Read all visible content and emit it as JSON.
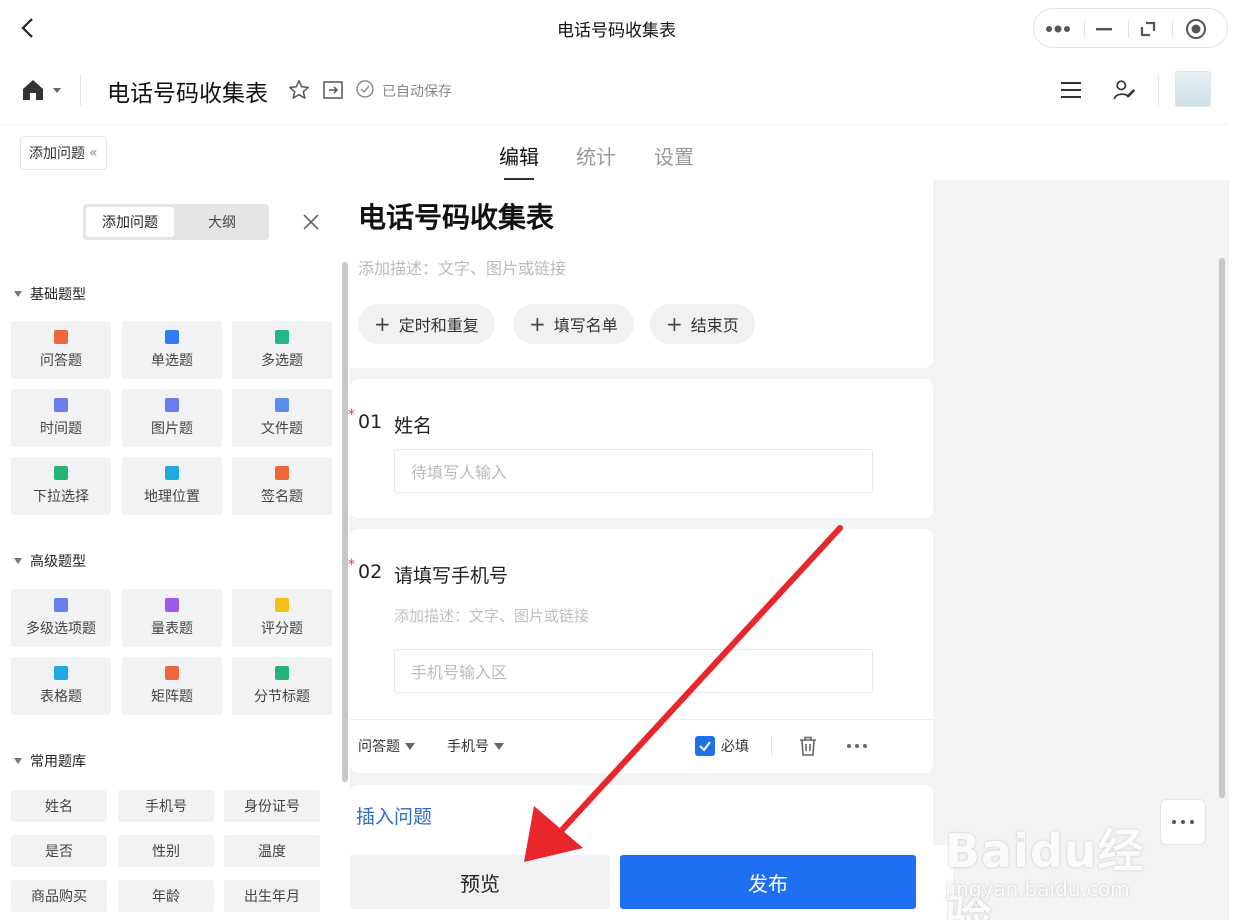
{
  "window": {
    "title": "电话号码收集表"
  },
  "doc": {
    "title": "电话号码收集表",
    "autosave": "已自动保存"
  },
  "tabs": {
    "add_question_btn": "添加问题",
    "items": [
      "编辑",
      "统计",
      "设置"
    ],
    "active": "编辑"
  },
  "left_panel": {
    "segment": [
      "添加问题",
      "大纲"
    ],
    "basic": {
      "heading": "基础题型",
      "items": [
        "问答题",
        "单选题",
        "多选题",
        "时间题",
        "图片题",
        "文件题",
        "下拉选择",
        "地理位置",
        "签名题"
      ],
      "icon_colors": [
        "#f0683a",
        "#2f7bf0",
        "#25b58a",
        "#6b7cf0",
        "#6b7cf0",
        "#5a8df0",
        "#22b573",
        "#20a8e0",
        "#f0683a"
      ]
    },
    "advanced": {
      "heading": "高级题型",
      "items": [
        "多级选项题",
        "量表题",
        "评分题",
        "表格题",
        "矩阵题",
        "分节标题"
      ],
      "icon_colors": [
        "#6b7cf0",
        "#9b59f0",
        "#f5c016",
        "#20a8e0",
        "#f0683a",
        "#22b573"
      ]
    },
    "common": {
      "heading": "常用题库",
      "items": [
        "姓名",
        "手机号",
        "身份证号",
        "是否",
        "性别",
        "温度",
        "商品购买",
        "年龄",
        "出生年月"
      ]
    }
  },
  "form": {
    "title": "电话号码收集表",
    "description_placeholder": "添加描述：文字、图片或链接",
    "chips": [
      "定时和重复",
      "填写名单",
      "结束页"
    ],
    "questions": [
      {
        "number": "01",
        "title": "姓名",
        "required_mark": "*",
        "placeholder": "待填写人输入"
      },
      {
        "number": "02",
        "title": "请填写手机号",
        "required_mark": "*",
        "description_placeholder": "添加描述：文字、图片或链接",
        "placeholder": "手机号输入区",
        "type_label": "问答题",
        "subtype_label": "手机号",
        "required_label": "必填"
      }
    ],
    "insert_label": "插入问题"
  },
  "bottom": {
    "preview": "预览",
    "publish": "发布"
  },
  "watermark": {
    "logo": "Baidu经验",
    "sub": "jingyan.baidu.com"
  },
  "colors": {
    "accent": "#1e6ff1",
    "arrow": "#e8262b",
    "link": "#2e6bc6"
  }
}
